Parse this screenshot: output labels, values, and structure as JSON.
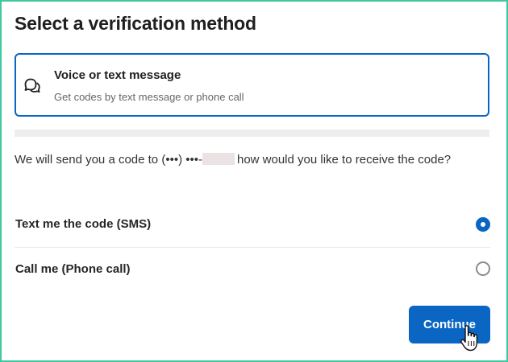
{
  "page": {
    "title": "Select a verification method"
  },
  "method_card": {
    "icon": "chat-bubbles-icon",
    "title": "Voice or text message",
    "subtitle": "Get codes by text message or phone call"
  },
  "info": {
    "text_before": "We will send you a code to (•••) •••-",
    "text_after": "how would you like to receive the code?"
  },
  "options": [
    {
      "label": "Text me the code (SMS)",
      "selected": true
    },
    {
      "label": "Call me (Phone call)",
      "selected": false
    }
  ],
  "continue_label": "Continue",
  "colors": {
    "accent": "#0a66c2",
    "frame_border": "#40c8a0",
    "divider": "#eeeeee"
  }
}
